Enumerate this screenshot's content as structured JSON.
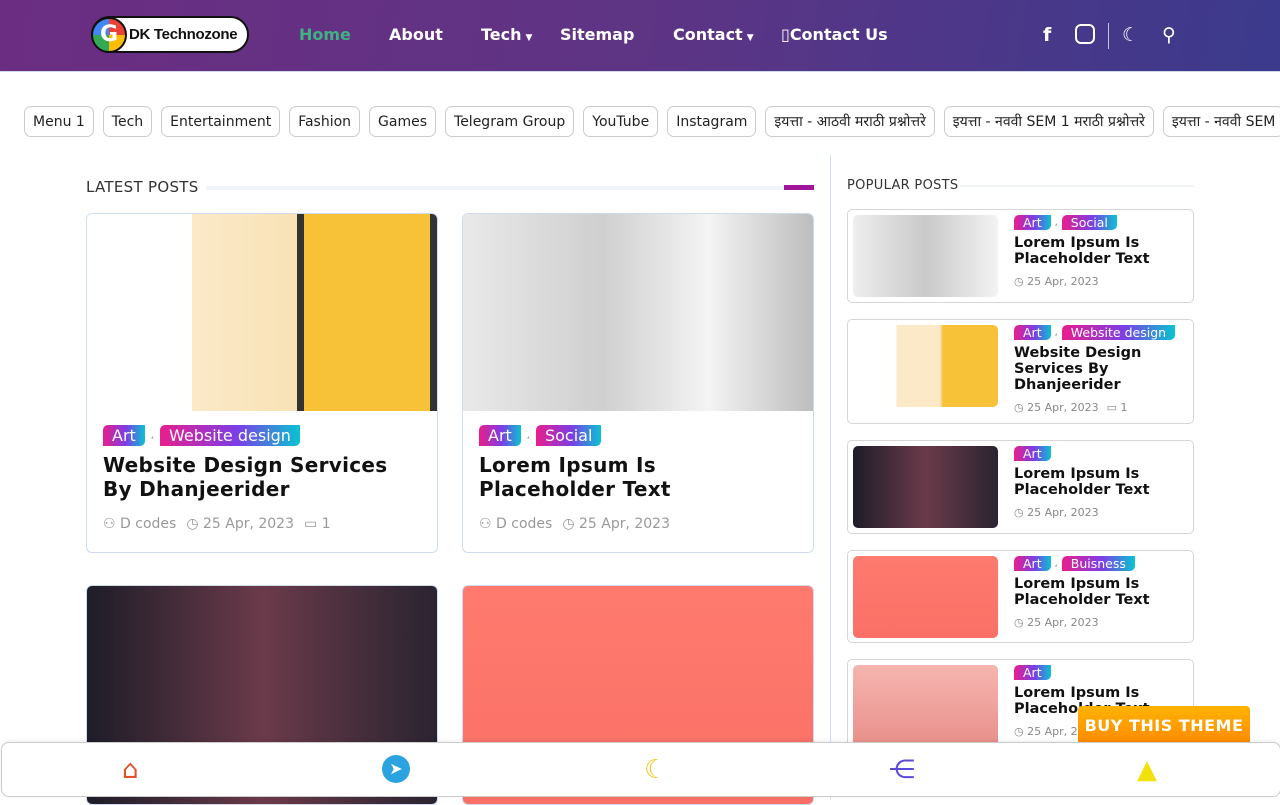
{
  "header": {
    "logo_text": "DK Technozone",
    "nav": [
      {
        "label": "Home",
        "active": true
      },
      {
        "label": "About"
      },
      {
        "label": "Tech",
        "dropdown": true
      },
      {
        "label": "Sitemap"
      },
      {
        "label": "Contact",
        "dropdown": true
      },
      {
        "label": "Contact Us"
      }
    ],
    "icons": [
      "facebook-icon",
      "instagram-icon",
      "moon-icon",
      "search-icon"
    ]
  },
  "chips": [
    "Menu 1",
    "Tech",
    "Entertainment",
    "Fashion",
    "Games",
    "Telegram Group",
    "YouTube",
    "Instagram",
    "इयत्ता - आठवी मराठी प्रश्नोत्तरे",
    "इयत्ता - नववी SEM 1 मराठी प्रश्नोत्तरे",
    "इयत्ता - नववी SEM"
  ],
  "latest": {
    "title": "LATEST POSTS",
    "posts": [
      {
        "tags": [
          "Art",
          "Website design"
        ],
        "title": "Website Design Services By Dhanjeerider",
        "author": "D codes",
        "date": "25 Apr, 2023",
        "comments": "1"
      },
      {
        "tags": [
          "Art",
          "Social"
        ],
        "title": "Lorem Ipsum Is Placeholder Text",
        "author": "D codes",
        "date": "25 Apr, 2023"
      }
    ]
  },
  "popular": {
    "title": "POPULAR POSTS",
    "posts": [
      {
        "tags": [
          "Art",
          "Social"
        ],
        "title": "Lorem Ipsum Is Placeholder Text",
        "date": "25 Apr, 2023"
      },
      {
        "tags": [
          "Art",
          "Website design"
        ],
        "title": "Website Design Services By Dhanjeerider",
        "date": "25 Apr, 2023",
        "comments": "1"
      },
      {
        "tags": [
          "Art"
        ],
        "title": "Lorem Ipsum Is Placeholder Text",
        "date": "25 Apr, 2023"
      },
      {
        "tags": [
          "Art",
          "Buisness"
        ],
        "title": "Lorem Ipsum Is Placeholder Text",
        "date": "25 Apr, 2023"
      },
      {
        "tags": [
          "Art"
        ],
        "title": "Lorem Ipsum Is Placeholder Text",
        "date": "25 Apr, 2023"
      }
    ]
  },
  "buy_button": "BUY THIS THEME",
  "colors": {
    "accent": "#3fb27f",
    "header_start": "#6b2d82",
    "header_end": "#3b3a8c",
    "buy": "#ff9800"
  }
}
